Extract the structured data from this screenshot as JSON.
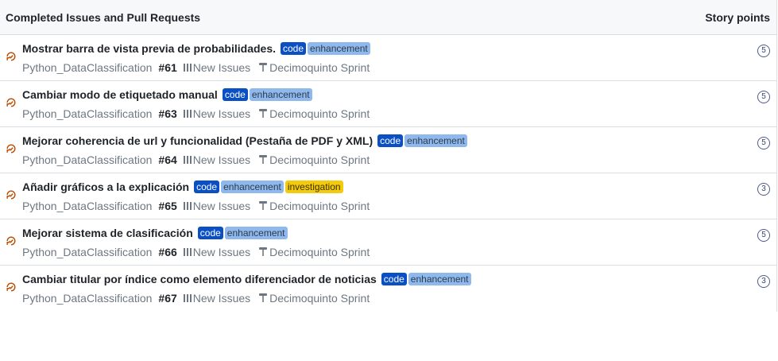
{
  "header": {
    "title": "Completed Issues and Pull Requests",
    "points_label": "Story points"
  },
  "colors": {
    "closed_icon": "#bc4c00",
    "label_code": "#0b4fc4",
    "label_enhancement": "#8fb8ec",
    "label_investigation": "#f2cc0c"
  },
  "issues": [
    {
      "title": "Mostrar barra de vista previa de probabilidades.",
      "labels": [
        "code",
        "enhancement"
      ],
      "repo": "Python_DataClassification",
      "number": "#61",
      "column": "New Issues",
      "milestone": "Decimoquinto Sprint",
      "points": "5"
    },
    {
      "title": "Cambiar modo de etiquetado manual",
      "labels": [
        "code",
        "enhancement"
      ],
      "repo": "Python_DataClassification",
      "number": "#63",
      "column": "New Issues",
      "milestone": "Decimoquinto Sprint",
      "points": "5"
    },
    {
      "title": "Mejorar coherencia de url y funcionalidad (Pestaña de PDF y XML)",
      "labels": [
        "code",
        "enhancement"
      ],
      "repo": "Python_DataClassification",
      "number": "#64",
      "column": "New Issues",
      "milestone": "Decimoquinto Sprint",
      "points": "5"
    },
    {
      "title": "Añadir gráficos a la explicación",
      "labels": [
        "code",
        "enhancement",
        "investigation"
      ],
      "repo": "Python_DataClassification",
      "number": "#65",
      "column": "New Issues",
      "milestone": "Decimoquinto Sprint",
      "points": "3"
    },
    {
      "title": "Mejorar sistema de clasificación",
      "labels": [
        "code",
        "enhancement"
      ],
      "repo": "Python_DataClassification",
      "number": "#66",
      "column": "New Issues",
      "milestone": "Decimoquinto Sprint",
      "points": "5"
    },
    {
      "title": "Cambiar titular por índice como elemento diferenciador de noticias",
      "labels": [
        "code",
        "enhancement"
      ],
      "repo": "Python_DataClassification",
      "number": "#67",
      "column": "New Issues",
      "milestone": "Decimoquinto Sprint",
      "points": "3"
    }
  ]
}
